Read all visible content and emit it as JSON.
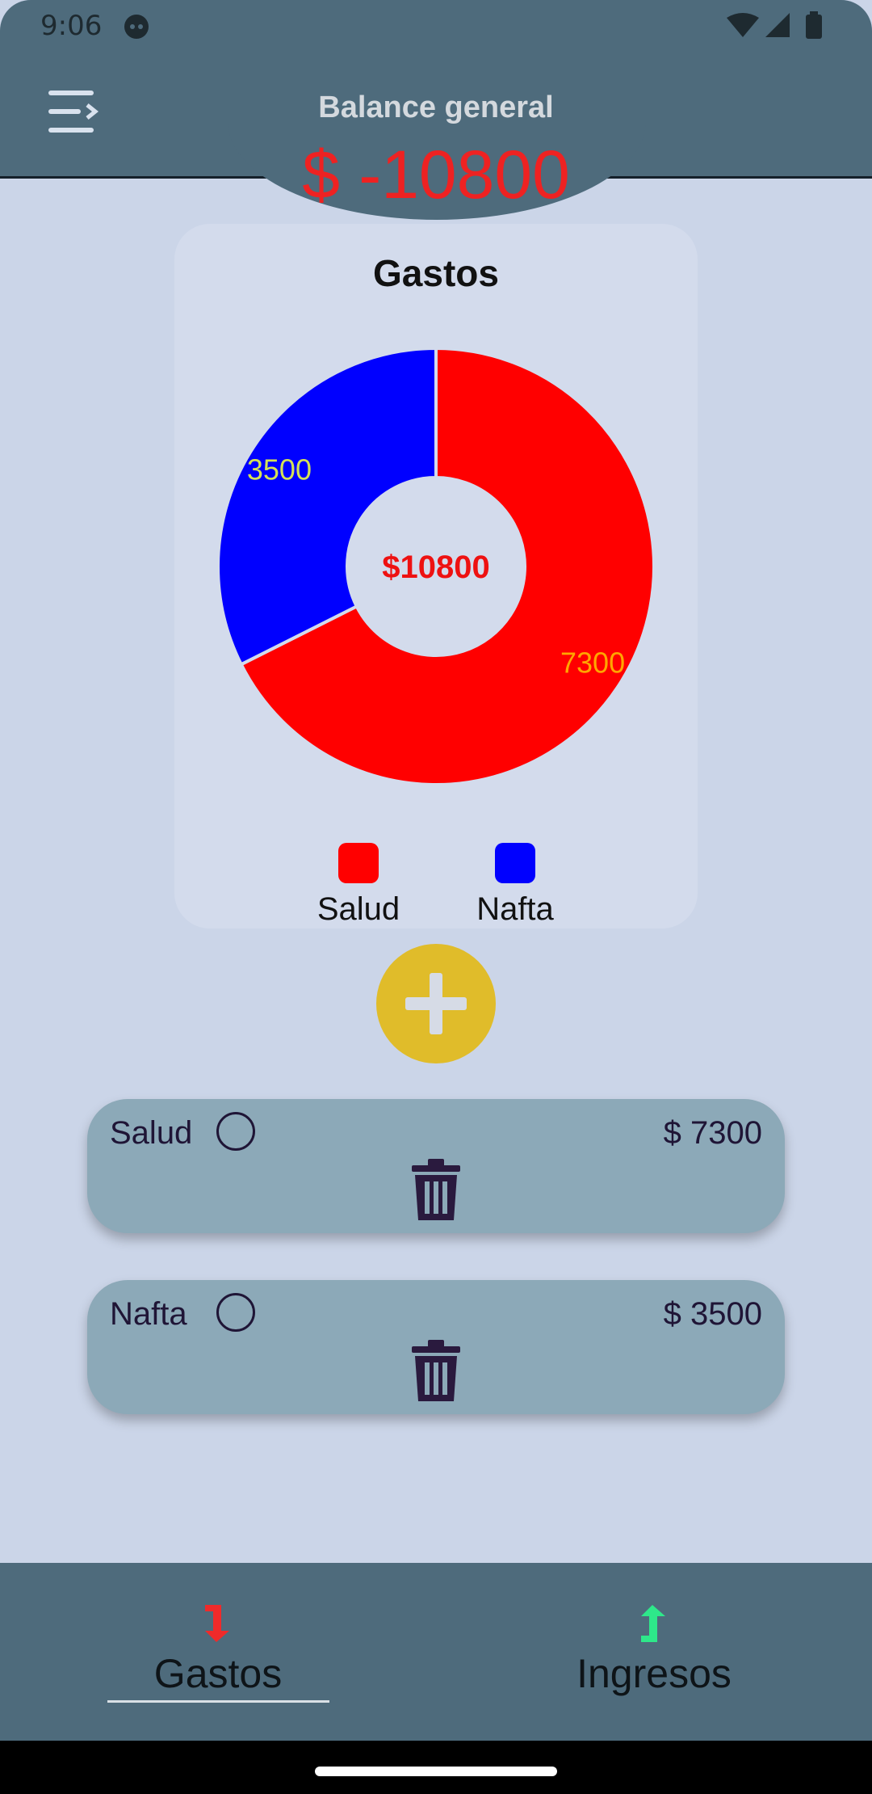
{
  "status_bar": {
    "time": "9:06"
  },
  "header": {
    "title": "Balance general",
    "balance": "$ -10800"
  },
  "chart_card": {
    "title": "Gastos",
    "center_total": "$10800"
  },
  "chart_data": {
    "type": "pie",
    "title": "Gastos",
    "donut": true,
    "center_label": "$10800",
    "categories": [
      "Salud",
      "Nafta"
    ],
    "values": [
      7300,
      3500
    ],
    "colors": [
      "#ff0000",
      "#0000ff"
    ],
    "data_labels": [
      "7300",
      "3500"
    ],
    "data_label_colors": [
      "#ffa600",
      "#d4e157"
    ],
    "legend_position": "bottom"
  },
  "legend": [
    {
      "label": "Salud",
      "color": "#ff0000"
    },
    {
      "label": "Nafta",
      "color": "#0000ff"
    }
  ],
  "expenses": [
    {
      "name": "Salud",
      "amount": "$ 7300"
    },
    {
      "name": "Nafta",
      "amount": "$ 3500"
    }
  ],
  "bottom_nav": {
    "tabs": [
      {
        "label": "Gastos",
        "icon": "arrow-down-red-icon",
        "selected": true
      },
      {
        "label": "Ingresos",
        "icon": "arrow-up-green-icon",
        "selected": false
      }
    ]
  },
  "colors": {
    "header": "#4e6b7c",
    "background": "#cbd5e8",
    "card": "#8ca9b8",
    "add_button": "#e0bc2a",
    "balance_negative": "#ee2222"
  }
}
